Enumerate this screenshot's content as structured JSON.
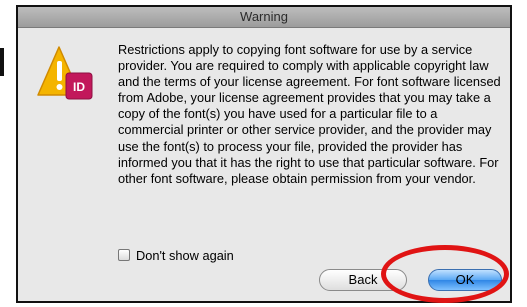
{
  "dialog": {
    "title": "Warning",
    "icon_badge": "ID",
    "message": "Restrictions apply to copying font software for use by a service provider.  You are required to comply with applicable copyright law and the terms of your license agreement.  For font software licensed from Adobe, your license agreement provides that you may take a copy of the font(s) you have used for a particular file to a commercial printer or other service provider, and the provider may use the font(s) to process your file, provided the provider has informed you that it has the right to use that particular software.  For other font software, please obtain permission from your vendor.",
    "checkbox_label": "Don't show again",
    "checkbox_checked": false,
    "back_label": "Back",
    "ok_label": "OK"
  },
  "colors": {
    "highlight_ring": "#e01414",
    "default_button": "#2f86e6",
    "warning_triangle": "#f4b400",
    "indesign_badge": "#c2185b"
  }
}
